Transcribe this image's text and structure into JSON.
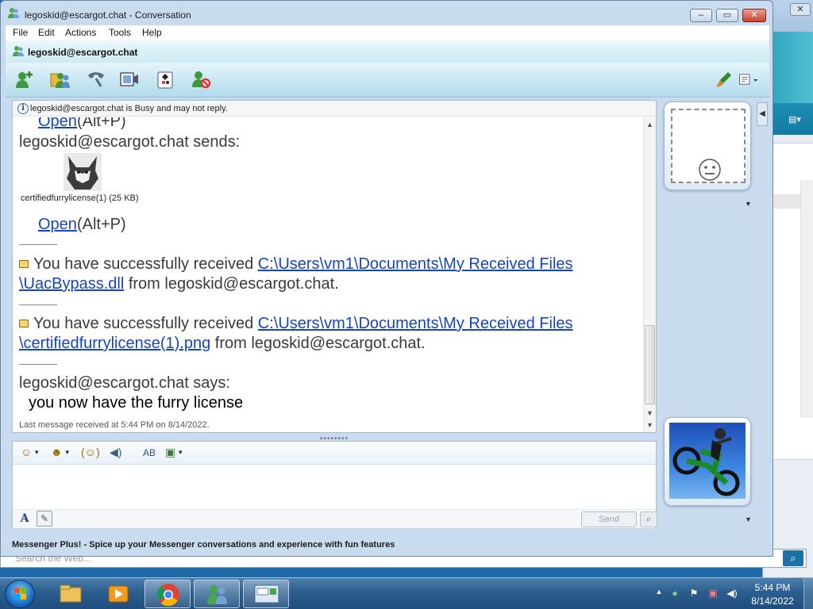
{
  "window": {
    "title": "legoskid@escargot.chat - Conversation",
    "minimize": "–",
    "maximize": "▭",
    "close": "✕"
  },
  "menu": [
    "File",
    "Edit",
    "Actions",
    "Tools",
    "Help"
  ],
  "contact": {
    "name": "legoskid@escargot.chat"
  },
  "toolbar": {
    "icons": [
      "invite-contact-icon",
      "share-contacts-icon",
      "call-icon",
      "video-icon",
      "games-icon",
      "block-icon",
      "paint-brush-icon",
      "layout-menu-icon"
    ]
  },
  "status_notice": "legoskid@escargot.chat is Busy and may not reply.",
  "log": {
    "open_link_1": "Open",
    "open_shortcut_1": "(Alt+P)",
    "sends_line": "legoskid@escargot.chat sends:",
    "file_caption": "certifiedfurrylicense(1) (25 KB)",
    "open_link_2": "Open",
    "open_shortcut_2": "(Alt+P)",
    "recv1_prefix": "You have successfully received ",
    "recv1_link_a": "C:\\Users\\vm1\\Documents\\My Received Files",
    "recv1_link_b": "\\UacBypass.dll",
    "recv1_suffix": " from legoskid@escargot.chat.",
    "recv2_prefix": "You have successfully received ",
    "recv2_link_a": "C:\\Users\\vm1\\Documents\\My Received Files",
    "recv2_link_b": "\\certifiedfurrylicense(1).png",
    "recv2_suffix": " from legoskid@escargot.chat.",
    "says_line": "legoskid@escargot.chat says:",
    "message": "you now have the furry license",
    "last_received": "Last message received at 5:44 PM on 8/14/2022."
  },
  "format_bar": {
    "icons": [
      "emoticon-icon",
      "wink-icon",
      "nudge-icon",
      "voice-clip-icon",
      "font-text-icon",
      "background-icon"
    ]
  },
  "compose": {
    "send_label": "Send",
    "font_label": "A"
  },
  "plus_banner": "Messenger Plus! - Spice up your Messenger conversations and experience with fun features",
  "background": {
    "search_placeholder": "Search the Web..."
  },
  "taskbar": {
    "time": "5:44 PM",
    "date": "8/14/2022",
    "apps": [
      "windows-explorer-icon",
      "media-player-icon",
      "chrome-icon",
      "messenger-icon",
      "conversation-window-icon"
    ]
  }
}
